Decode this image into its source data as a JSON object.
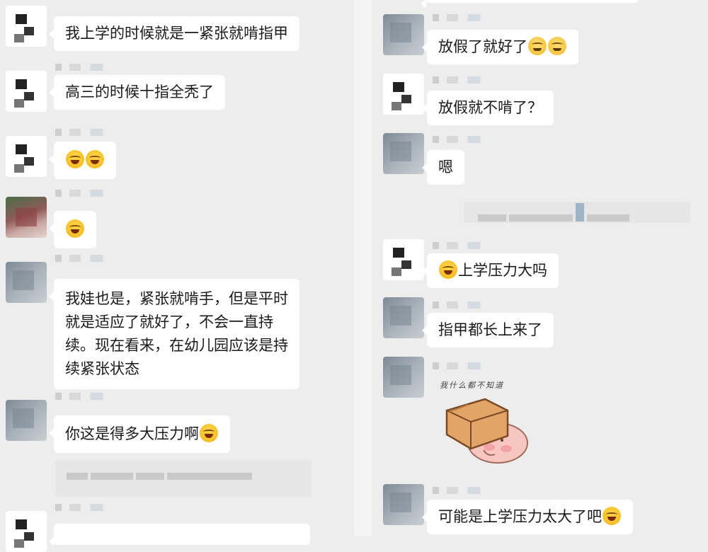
{
  "left_column": {
    "messages": [
      {
        "text_lines": [
          "我上学的时候就是一紧张就啃指甲"
        ]
      },
      {
        "text_lines": [
          "高三的时候十指全秃了"
        ]
      },
      {
        "emojis": [
          "laugh-cry",
          "laugh-cry"
        ]
      },
      {
        "emojis": [
          "laugh-cry"
        ]
      },
      {
        "text_lines": [
          "我娃也是，紧张就啃手，但是平时",
          "就是适应了就好了，不会一直持",
          "续。现在看来，在幼儿园应该是持",
          "续紧张状态"
        ]
      },
      {
        "text": "你这是得多大压力啊",
        "trailing_emoji": "laugh-cry"
      }
    ]
  },
  "right_column": {
    "messages": [
      {
        "text": "放假了就好了",
        "trailing_emojis": [
          "crying-face",
          "crying-face"
        ]
      },
      {
        "text": "放假就不啃了？"
      },
      {
        "text": "嗯"
      },
      {
        "text": "上学压力大吗",
        "leading_emoji": "laugh-cry"
      },
      {
        "text": "指甲都长上来了"
      },
      {
        "sticker_caption": "我什么都不知道"
      },
      {
        "text": "可能是上学压力太大了吧",
        "trailing_emoji": "laugh-cry"
      }
    ]
  }
}
